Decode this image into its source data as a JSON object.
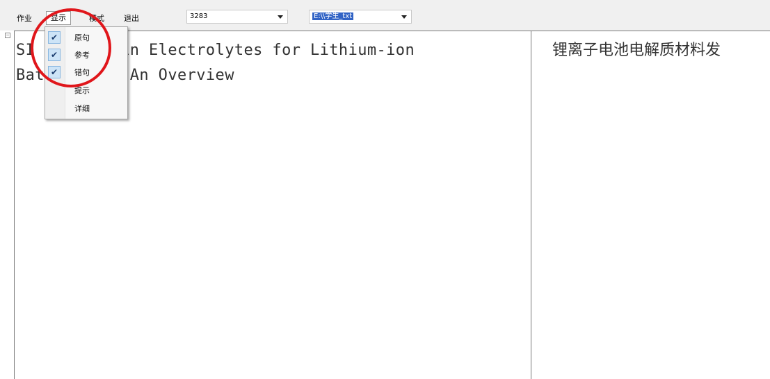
{
  "menubar": {
    "items": [
      {
        "label": "作业"
      },
      {
        "label": "显示"
      },
      {
        "label": "模式"
      },
      {
        "label": "退出"
      }
    ],
    "combo_number": {
      "value": "3283"
    },
    "combo_file": {
      "value": "E:\\\\学生_txt"
    }
  },
  "dropdown": {
    "items": [
      {
        "label": "原句",
        "checked": true
      },
      {
        "label": "参考",
        "checked": true
      },
      {
        "label": "错句",
        "checked": true
      },
      {
        "label": "提示",
        "checked": false
      },
      {
        "label": "详细",
        "checked": false
      }
    ],
    "check_glyph": "✔"
  },
  "left_pane": {
    "line1": "SI         in Electrolytes for Lithium-ion",
    "line2": "Bat         An Overview"
  },
  "right_pane": {
    "text": "锂离子电池电解质材料发"
  },
  "expander": {
    "symbol": "−"
  },
  "colors": {
    "highlight_circle": "#e0161b",
    "selection": "#3163c5"
  }
}
